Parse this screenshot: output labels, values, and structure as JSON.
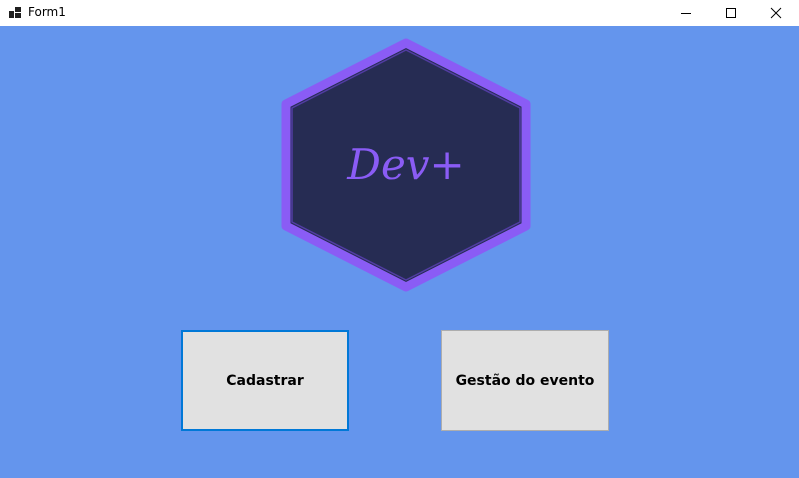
{
  "window": {
    "title": "Form1",
    "background_color": "#6495ed",
    "controls": {
      "minimize_icon": "minimize-icon",
      "maximize_icon": "maximize-icon",
      "close_icon": "close-icon"
    }
  },
  "logo": {
    "text": "Dev+",
    "fill_color": "#262c53",
    "border_color": "#8a5cf5",
    "text_color": "#8a5cf5"
  },
  "buttons": {
    "cadastrar": "Cadastrar",
    "gestao": "Gestão do evento",
    "focus_color": "#0078d7"
  }
}
